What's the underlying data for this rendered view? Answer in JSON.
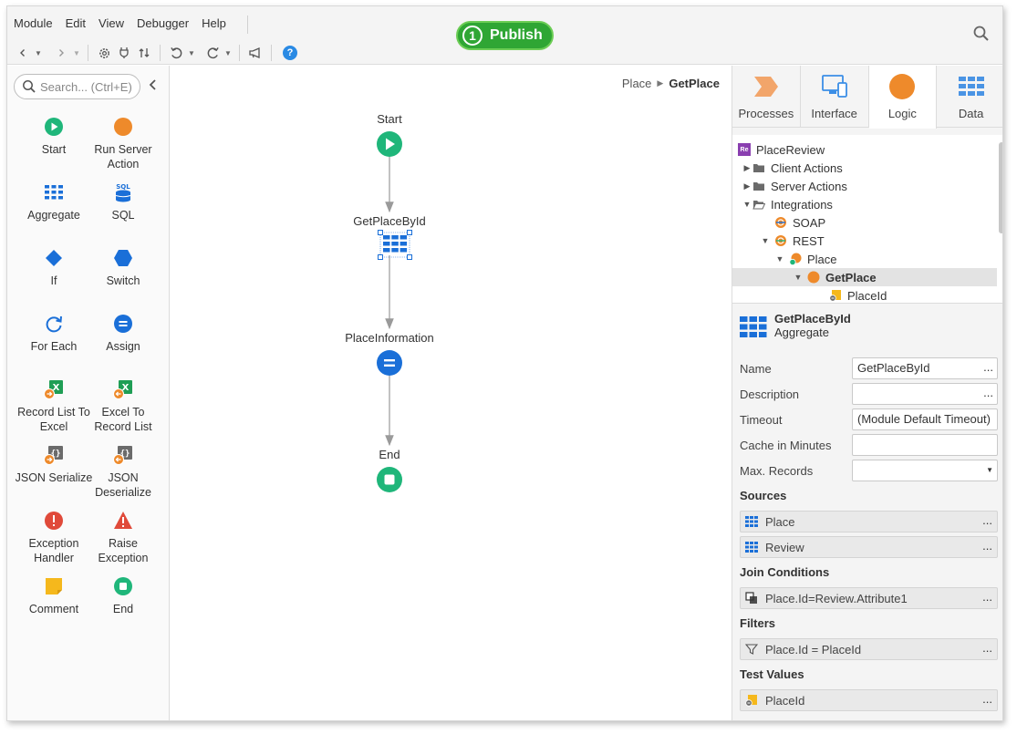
{
  "menu": [
    "Module",
    "Edit",
    "View",
    "Debugger",
    "Help"
  ],
  "publish": {
    "number": "1",
    "label": "Publish",
    "color": "#2fa634"
  },
  "toolbox": {
    "search_placeholder": "Search... (Ctrl+E)",
    "tools": [
      {
        "label": "Start",
        "icon": "start-icon"
      },
      {
        "label": "Run Server Action",
        "icon": "run-server-action-icon"
      },
      {
        "label": "Aggregate",
        "icon": "aggregate-icon"
      },
      {
        "label": "SQL",
        "icon": "sql-icon"
      },
      {
        "label": "If",
        "icon": "if-icon"
      },
      {
        "label": "Switch",
        "icon": "switch-icon"
      },
      {
        "label": "For Each",
        "icon": "for-each-icon"
      },
      {
        "label": "Assign",
        "icon": "assign-icon"
      },
      {
        "label": "Record List To Excel",
        "icon": "record-list-to-excel-icon"
      },
      {
        "label": "Excel To Record List",
        "icon": "excel-to-record-list-icon"
      },
      {
        "label": "JSON Serialize",
        "icon": "json-serialize-icon"
      },
      {
        "label": "JSON Deserialize",
        "icon": "json-deserialize-icon"
      },
      {
        "label": "Exception Handler",
        "icon": "exception-handler-icon"
      },
      {
        "label": "Raise Exception",
        "icon": "raise-exception-icon"
      },
      {
        "label": "Comment",
        "icon": "comment-icon"
      },
      {
        "label": "End",
        "icon": "end-icon"
      }
    ]
  },
  "canvas": {
    "breadcrumb": {
      "parent": "Place",
      "current": "GetPlace"
    },
    "nodes": {
      "start": "Start",
      "aggregate": "GetPlaceById",
      "assign": "PlaceInformation",
      "end": "End"
    }
  },
  "tabs": [
    {
      "label": "Processes",
      "icon": "processes-icon"
    },
    {
      "label": "Interface",
      "icon": "interface-icon"
    },
    {
      "label": "Logic",
      "icon": "logic-icon",
      "active": true
    },
    {
      "label": "Data",
      "icon": "data-icon"
    }
  ],
  "tree": {
    "module": "PlaceReview",
    "module_badge": "Re",
    "items": [
      "Client Actions",
      "Server Actions",
      "Integrations",
      "SOAP",
      "REST",
      "Place",
      "GetPlace",
      "PlaceId"
    ]
  },
  "properties": {
    "title": "GetPlaceById",
    "subtitle": "Aggregate",
    "name_label": "Name",
    "name_value": "GetPlaceById",
    "description_label": "Description",
    "description_value": "",
    "timeout_label": "Timeout",
    "timeout_value": "(Module Default Timeout)",
    "cache_label": "Cache in Minutes",
    "cache_value": "",
    "maxrecords_label": "Max. Records",
    "maxrecords_value": "",
    "sources_title": "Sources",
    "sources": [
      "Place",
      "Review"
    ],
    "join_title": "Join Conditions",
    "join": "Place.Id=Review.Attribute1",
    "filters_title": "Filters",
    "filter": "Place.Id = PlaceId",
    "test_title": "Test Values",
    "test_value": "PlaceId"
  },
  "colors": {
    "accent": "#2a8ae4",
    "logic_orange": "#ee8a2b",
    "start_green": "#1fb67a",
    "sql_blue": "#1a6fd8"
  }
}
